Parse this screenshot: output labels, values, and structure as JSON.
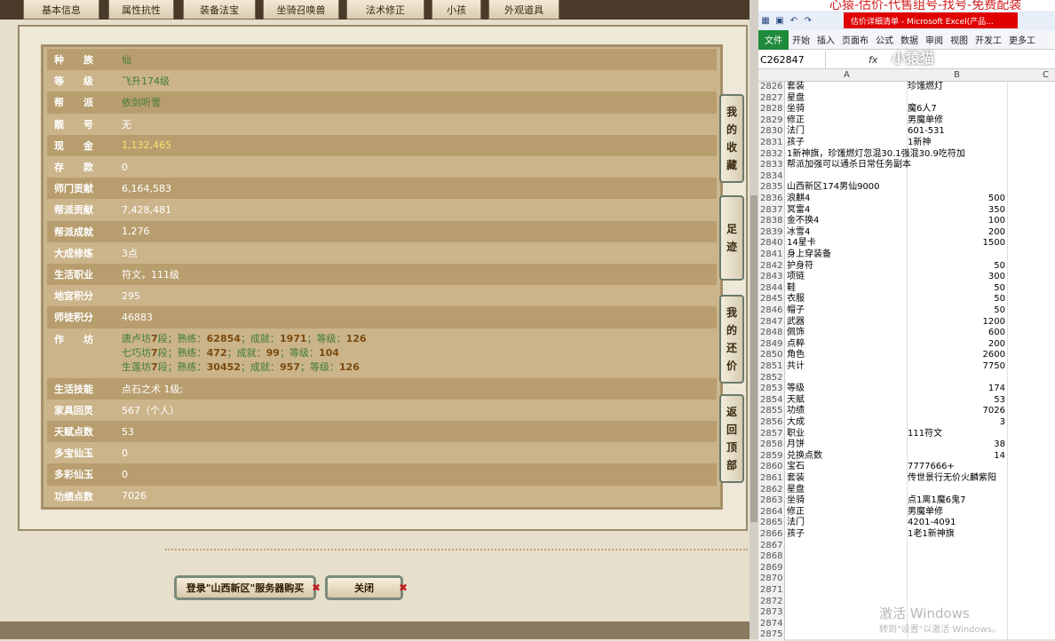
{
  "tabs": [
    "基本信息",
    "属性抗性",
    "装备法宝",
    "坐骑召唤兽",
    "法术修正",
    "小孩",
    "外观道具"
  ],
  "rows": [
    {
      "k": "种　　族",
      "v": "仙",
      "c": "green"
    },
    {
      "k": "等　　级",
      "v": "飞升174级",
      "c": "green"
    },
    {
      "k": "帮　　派",
      "v": "依剑听雪",
      "c": "green"
    },
    {
      "k": "靓　　号",
      "v": "无",
      "c": ""
    },
    {
      "k": "现　　金",
      "v": "1,132,465",
      "c": "gold"
    },
    {
      "k": "存　　款",
      "v": "0",
      "c": ""
    },
    {
      "k": "师门贡献",
      "v": "6,164,583",
      "c": ""
    },
    {
      "k": "帮派贡献",
      "v": "7,428,481",
      "c": ""
    },
    {
      "k": "帮派成就",
      "v": "1,276",
      "c": ""
    },
    {
      "k": "大成修炼",
      "v": "3点",
      "c": ""
    },
    {
      "k": "生活职业",
      "v": "符文，111级",
      "c": ""
    },
    {
      "k": "地宫积分",
      "v": "295",
      "c": ""
    },
    {
      "k": "师徒积分",
      "v": "46883",
      "c": ""
    }
  ],
  "workshop": {
    "k": "作　　坊",
    "lines": [
      {
        "name": "唐卢坊",
        "lv": "7",
        "exp": "62854",
        "ach": "1971",
        "grade": "126"
      },
      {
        "name": "七巧坊",
        "lv": "7",
        "exp": "472",
        "ach": "99",
        "grade": "104"
      },
      {
        "name": "生莲坊",
        "lv": "7",
        "exp": "30452",
        "ach": "957",
        "grade": "126"
      }
    ],
    "seg": "段；熟练：",
    "ach_l": "；成就：",
    "grade_l": "；等级："
  },
  "rows2": [
    {
      "k": "生活技能",
      "v": "点石之术 1级;",
      "c": ""
    },
    {
      "k": "家具回灵",
      "v": "567（个人）",
      "c": ""
    },
    {
      "k": "天赋点数",
      "v": "53",
      "c": ""
    },
    {
      "k": "多宝仙玉",
      "v": "0",
      "c": ""
    },
    {
      "k": "多彩仙玉",
      "v": "0",
      "c": ""
    },
    {
      "k": "功绩点数",
      "v": "7026",
      "c": ""
    }
  ],
  "side_buttons": [
    "我的收藏",
    "足迹",
    "我的还价",
    "返回顶部"
  ],
  "bottom": {
    "login": "登录\"山西新区\"服务器购买",
    "close": "关闭"
  },
  "excel": {
    "promo": "心猿-估价-代售组号-找号-免费配装",
    "title": "估价详细清单 - Microsoft Excel(产品...",
    "ribbon": [
      "文件",
      "开始",
      "插入",
      "页面布",
      "公式",
      "数据",
      "审阅",
      "视图",
      "开发工",
      "更多工"
    ],
    "namebox": "C262847",
    "fx": "fx",
    "cols": [
      "A",
      "B",
      "C"
    ],
    "rows": [
      [
        "2826",
        "套装",
        "珍馐燃灯",
        ""
      ],
      [
        "2827",
        "星盘",
        "",
        ""
      ],
      [
        "2828",
        "坐骑",
        "魔6人7",
        ""
      ],
      [
        "2829",
        "修正",
        "男魔单修",
        ""
      ],
      [
        "2830",
        "法门",
        "601-531",
        ""
      ],
      [
        "2831",
        "孩子",
        "1新神",
        ""
      ],
      [
        "2832",
        "1新神旗，珍馐燃灯忽混30.1强混30.9吃符加",
        "",
        ""
      ],
      [
        "2833",
        "帮派加强可以通杀日常任务副本",
        "",
        ""
      ],
      [
        "2834",
        "",
        "",
        ""
      ],
      [
        "2835",
        "山西新区174男仙9000",
        "",
        ""
      ],
      [
        "2836",
        "浪麒4",
        "",
        "500"
      ],
      [
        "2837",
        "冥雷4",
        "",
        "350"
      ],
      [
        "2838",
        "金不换4",
        "",
        "100"
      ],
      [
        "2839",
        "冰雪4",
        "",
        "200"
      ],
      [
        "2840",
        "14星卡",
        "",
        "1500"
      ],
      [
        "2841",
        "身上穿装备",
        "",
        ""
      ],
      [
        "2842",
        "护身符",
        "",
        "50"
      ],
      [
        "2843",
        "项链",
        "",
        "300"
      ],
      [
        "2844",
        "鞋",
        "",
        "50"
      ],
      [
        "2845",
        "衣服",
        "",
        "50"
      ],
      [
        "2846",
        "帽子",
        "",
        "50"
      ],
      [
        "2847",
        "武器",
        "",
        "1200"
      ],
      [
        "2848",
        "佩饰",
        "",
        "600"
      ],
      [
        "2849",
        "点粹",
        "",
        "200"
      ],
      [
        "2850",
        "角色",
        "",
        "2600"
      ],
      [
        "2851",
        "共计",
        "",
        "7750"
      ],
      [
        "2852",
        "",
        "",
        ""
      ],
      [
        "2853",
        "等级",
        "",
        "174"
      ],
      [
        "2854",
        "天赋",
        "",
        "53"
      ],
      [
        "2855",
        "功绩",
        "",
        "7026"
      ],
      [
        "2856",
        "大成",
        "",
        "3"
      ],
      [
        "2857",
        "职业",
        "111符文",
        ""
      ],
      [
        "2858",
        "月饼",
        "",
        "38"
      ],
      [
        "2859",
        "兑换点数",
        "",
        "14"
      ],
      [
        "2860",
        "宝石",
        "7777666+",
        ""
      ],
      [
        "2861",
        "套装",
        "传世景行无价火麟紫阳",
        ""
      ],
      [
        "2862",
        "星盘",
        "",
        ""
      ],
      [
        "2863",
        "坐骑",
        "点1离1魔6鬼7",
        ""
      ],
      [
        "2864",
        "修正",
        "男魔单修",
        ""
      ],
      [
        "2865",
        "法门",
        "4201-4091",
        ""
      ],
      [
        "2866",
        "孩子",
        "1老1新神旗",
        ""
      ],
      [
        "2867",
        "",
        "",
        ""
      ],
      [
        "2868",
        "",
        "",
        ""
      ],
      [
        "2869",
        "",
        "",
        ""
      ],
      [
        "2870",
        "",
        "",
        ""
      ],
      [
        "2871",
        "",
        "",
        ""
      ],
      [
        "2872",
        "",
        "",
        ""
      ],
      [
        "2873",
        "",
        "",
        ""
      ],
      [
        "2874",
        "",
        "",
        ""
      ],
      [
        "2875",
        "",
        "",
        ""
      ]
    ],
    "watermark": "激活 Windows",
    "watermark2": "转到\"设置\"以激活 Windows。",
    "logo": "小猿猫"
  }
}
